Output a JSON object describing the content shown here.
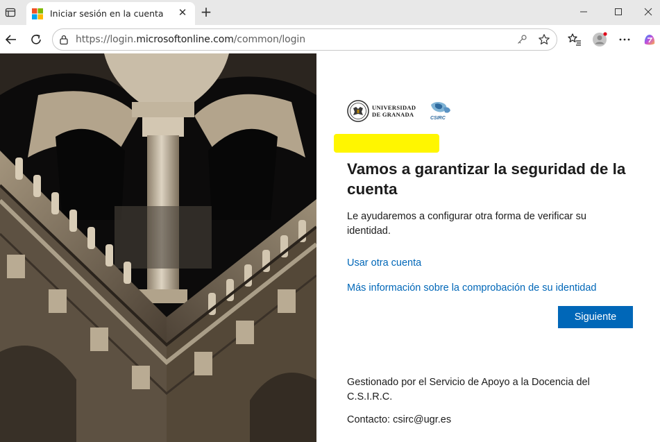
{
  "browser": {
    "tab_title": "Iniciar sesión en la cuenta",
    "url_prefix": "https://login.",
    "url_domain": "microsoftonline.com",
    "url_path": "/common/login"
  },
  "logo": {
    "university_line1": "UNIVERSIDAD",
    "university_line2": "DE GRANADA",
    "csirc_label": "CSIRC"
  },
  "content": {
    "heading": "Vamos a garantizar la seguridad de la cuenta",
    "description": "Le ayudaremos a configurar otra forma de verificar su identidad.",
    "link_other_account": "Usar otra cuenta",
    "link_more_info": "Más información sobre la comprobación de su identidad",
    "next_button": "Siguiente",
    "footer_managed": "Gestionado por el Servicio de Apoyo a la Docencia del C.S.I.R.C.",
    "footer_contact": "Contacto: csirc@ugr.es"
  },
  "colors": {
    "accent": "#0067b8",
    "redaction": "#fff600"
  }
}
